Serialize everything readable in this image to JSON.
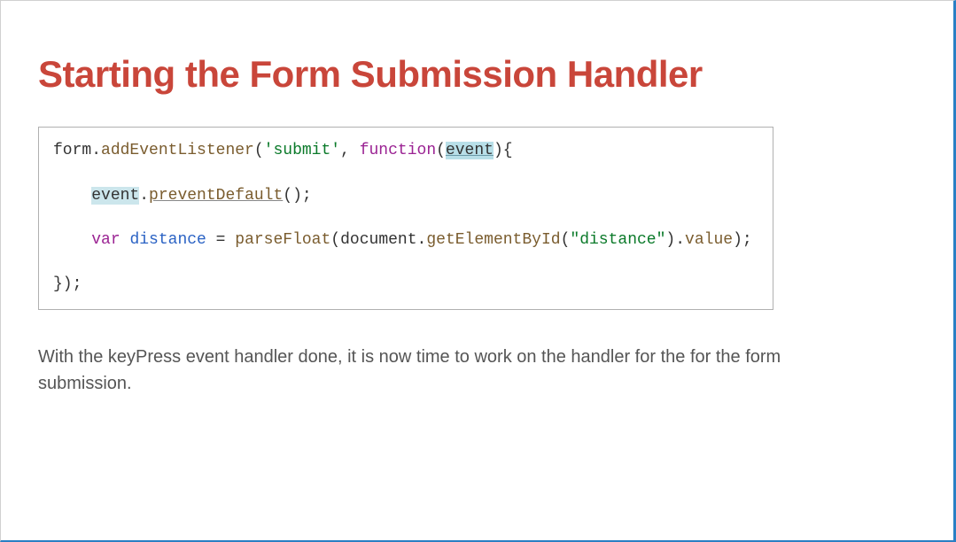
{
  "slide": {
    "title": "Starting the Form Submission Handler",
    "body_text": "With the keyPress event handler done, it is now time to work on the handler for the for the form submission."
  },
  "code": {
    "line1": {
      "obj": "form",
      "dot1": ".",
      "method": "addEventListener",
      "open": "(",
      "arg1": "'submit'",
      "comma": ", ",
      "kw": "function",
      "paren_open": "(",
      "param": "event",
      "paren_close": ")",
      "brace": "{"
    },
    "line2": {
      "indent": "    ",
      "obj": "event",
      "dot": ".",
      "method": "preventDefault",
      "call": "();"
    },
    "line3": {
      "indent": "    ",
      "kw": "var",
      "sp1": " ",
      "varname": "distance",
      "eq": " = ",
      "fn": "parseFloat",
      "open": "(",
      "doc": "document",
      "dot": ".",
      "method": "getElementById",
      "open2": "(",
      "arg": "\"distance\"",
      "close2": ")",
      "dot2": ".",
      "prop": "value",
      "close": ");"
    },
    "line4": "});"
  }
}
